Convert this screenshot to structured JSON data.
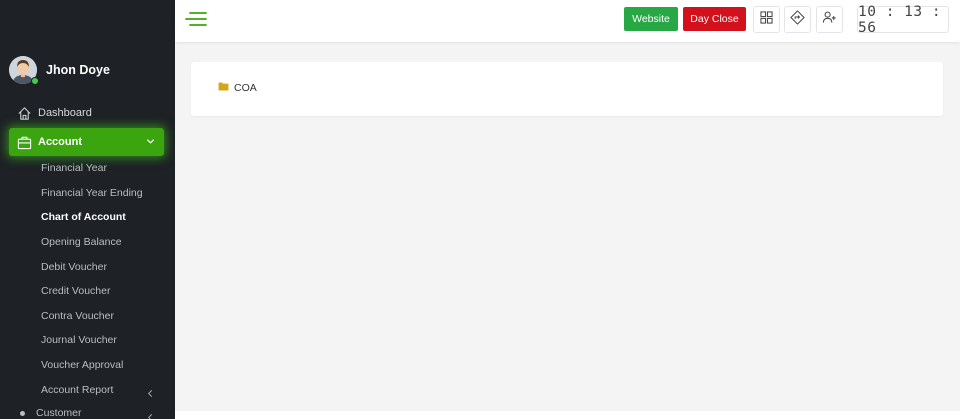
{
  "user": {
    "name": "Jhon Doye",
    "status_color": "#3fcf4a"
  },
  "sidebar": {
    "items": [
      {
        "label": "Dashboard",
        "icon": "home-icon"
      },
      {
        "label": "Account",
        "icon": "briefcase-icon",
        "active": true
      }
    ],
    "account_submenu": [
      "Financial Year",
      "Financial Year Ending",
      "Chart of Account",
      "Opening Balance",
      "Debit Voucher",
      "Credit Voucher",
      "Contra Voucher",
      "Journal Voucher",
      "Voucher Approval",
      "Account Report"
    ],
    "active_submenu": "Chart of Account",
    "customer_label": "Customer"
  },
  "header": {
    "website_label": "Website",
    "day_close_label": "Day Close",
    "clock": "10 : 13 : 56"
  },
  "tree": {
    "root_label": "COA"
  },
  "colors": {
    "accent_green": "#3aa50f",
    "website_green": "#28a745",
    "day_close_red": "#d3111c",
    "sidebar_bg": "#1e2125",
    "folder": "#d4a514"
  }
}
